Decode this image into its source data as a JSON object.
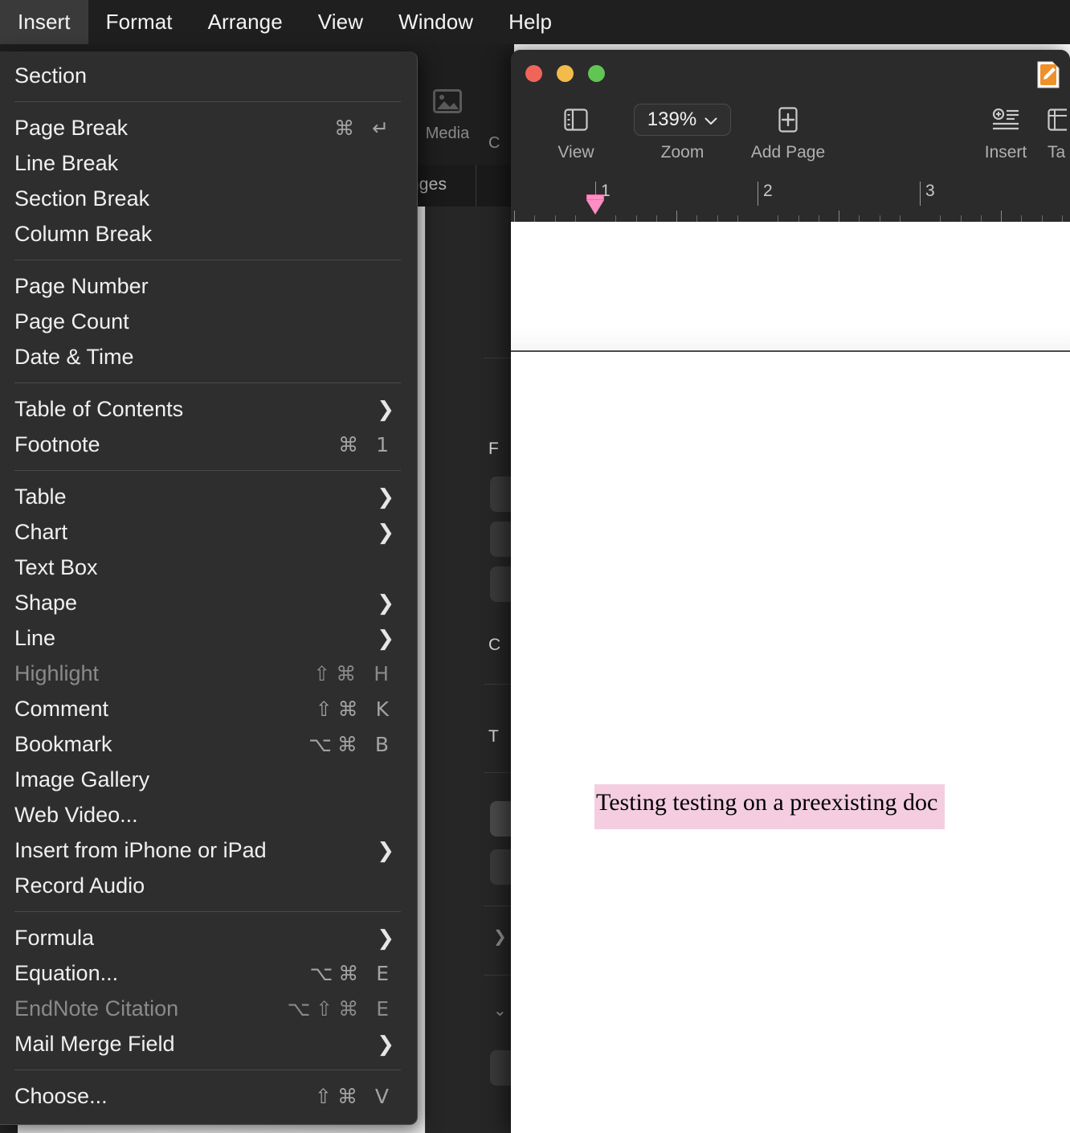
{
  "menubar": {
    "items": [
      {
        "label": "Insert",
        "active": true
      },
      {
        "label": "Format",
        "active": false
      },
      {
        "label": "Arrange",
        "active": false
      },
      {
        "label": "View",
        "active": false
      },
      {
        "label": "Window",
        "active": false
      },
      {
        "label": "Help",
        "active": false
      }
    ]
  },
  "insert_menu": {
    "groups": [
      {
        "items": [
          {
            "label": "Section",
            "accel": "",
            "submenu": false,
            "disabled": false
          }
        ]
      },
      {
        "items": [
          {
            "label": "Page Break",
            "accel": "⌘ ↵",
            "submenu": false,
            "disabled": false
          },
          {
            "label": "Line Break",
            "accel": "",
            "submenu": false,
            "disabled": false
          },
          {
            "label": "Section Break",
            "accel": "",
            "submenu": false,
            "disabled": false
          },
          {
            "label": "Column Break",
            "accel": "",
            "submenu": false,
            "disabled": false
          }
        ]
      },
      {
        "items": [
          {
            "label": "Page Number",
            "accel": "",
            "submenu": false,
            "disabled": false
          },
          {
            "label": "Page Count",
            "accel": "",
            "submenu": false,
            "disabled": false
          },
          {
            "label": "Date & Time",
            "accel": "",
            "submenu": false,
            "disabled": false
          }
        ]
      },
      {
        "items": [
          {
            "label": "Table of Contents",
            "accel": "",
            "submenu": true,
            "disabled": false
          },
          {
            "label": "Footnote",
            "accel": "⌘ 1",
            "submenu": false,
            "disabled": false
          }
        ]
      },
      {
        "items": [
          {
            "label": "Table",
            "accel": "",
            "submenu": true,
            "disabled": false
          },
          {
            "label": "Chart",
            "accel": "",
            "submenu": true,
            "disabled": false
          },
          {
            "label": "Text Box",
            "accel": "",
            "submenu": false,
            "disabled": false
          },
          {
            "label": "Shape",
            "accel": "",
            "submenu": true,
            "disabled": false
          },
          {
            "label": "Line",
            "accel": "",
            "submenu": true,
            "disabled": false
          },
          {
            "label": "Highlight",
            "accel": "⇧⌘ H",
            "submenu": false,
            "disabled": true
          },
          {
            "label": "Comment",
            "accel": "⇧⌘ K",
            "submenu": false,
            "disabled": false
          },
          {
            "label": "Bookmark",
            "accel": "⌥⌘ B",
            "submenu": false,
            "disabled": false
          },
          {
            "label": "Image Gallery",
            "accel": "",
            "submenu": false,
            "disabled": false
          },
          {
            "label": "Web Video...",
            "accel": "",
            "submenu": false,
            "disabled": false
          },
          {
            "label": "Insert from iPhone or iPad",
            "accel": "",
            "submenu": true,
            "disabled": false
          },
          {
            "label": "Record Audio",
            "accel": "",
            "submenu": false,
            "disabled": false
          }
        ]
      },
      {
        "items": [
          {
            "label": "Formula",
            "accel": "",
            "submenu": true,
            "disabled": false
          },
          {
            "label": "Equation...",
            "accel": "⌥⌘ E",
            "submenu": false,
            "disabled": false
          },
          {
            "label": "EndNote Citation",
            "accel": "⌥⇧⌘ E",
            "submenu": false,
            "disabled": true
          },
          {
            "label": "Mail Merge Field",
            "accel": "",
            "submenu": true,
            "disabled": false
          }
        ]
      },
      {
        "items": [
          {
            "label": "Choose...",
            "accel": "⇧⌘ V",
            "submenu": false,
            "disabled": false
          }
        ]
      }
    ]
  },
  "background_window": {
    "toolbar": {
      "media_label": "Media",
      "next_label": "C"
    },
    "subbar": {
      "changes_label": "anges"
    },
    "side_pane": {
      "headings": [
        "F",
        "C",
        "T"
      ]
    }
  },
  "document_window": {
    "traffic_lights": [
      "close",
      "minimize",
      "zoom"
    ],
    "toolbar": {
      "view_label": "View",
      "zoom_label": "Zoom",
      "zoom_value": "139%",
      "add_page_label": "Add Page",
      "insert_label": "Insert",
      "table_label": "Ta"
    },
    "ruler": {
      "unit_numbers": [
        "1",
        "2",
        "3"
      ],
      "indent_marker_color": "#ff8ec4"
    },
    "body": {
      "paragraph_text": "Testing testing on a preexisting doc",
      "highlight_color": "#f4cde1"
    }
  }
}
